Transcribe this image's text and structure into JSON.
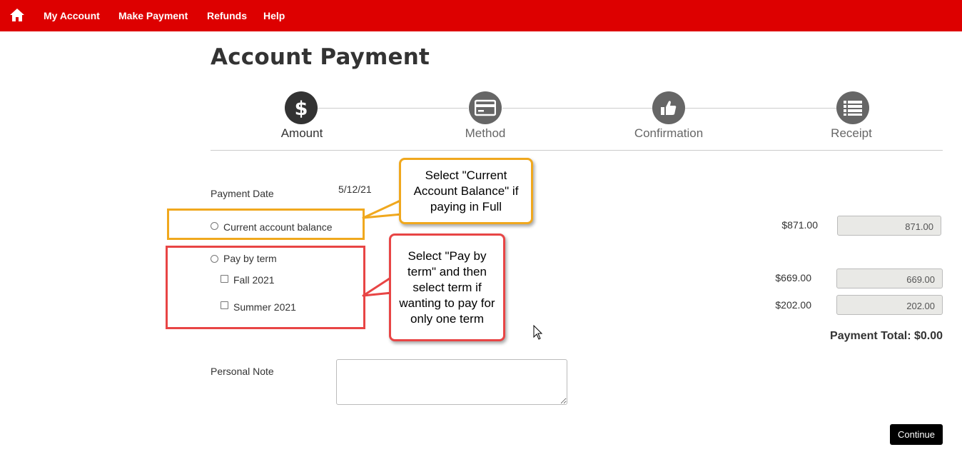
{
  "nav": {
    "home_icon": "home-icon",
    "items": [
      "My Account",
      "Make Payment",
      "Refunds",
      "Help"
    ]
  },
  "page": {
    "title": "Account Payment"
  },
  "steps": [
    {
      "label": "Amount",
      "icon": "dollar-icon",
      "active": true
    },
    {
      "label": "Method",
      "icon": "credit-card-icon",
      "active": false
    },
    {
      "label": "Confirmation",
      "icon": "thumbs-up-icon",
      "active": false
    },
    {
      "label": "Receipt",
      "icon": "list-icon",
      "active": false
    }
  ],
  "form": {
    "payment_date_label": "Payment Date",
    "payment_date_value": "5/12/21",
    "current_balance_label": "Current account balance",
    "current_balance_amount": "$871.00",
    "current_balance_input": "871.00",
    "pay_by_term_label": "Pay by term",
    "terms": [
      {
        "label": "Fall 2021",
        "amount": "$669.00",
        "input": "669.00"
      },
      {
        "label": "Summer 2021",
        "amount": "$202.00",
        "input": "202.00"
      }
    ],
    "payment_total": "Payment Total: $0.00",
    "personal_note_label": "Personal Note",
    "personal_note_value": "",
    "continue_label": "Continue"
  },
  "callouts": {
    "balance": "Select \"Current Account Balance\" if paying in Full",
    "term": "Select \"Pay by term\" and then select  term if wanting to pay for only one term"
  },
  "colors": {
    "brand_red": "#dd0000",
    "callout_orange": "#f0a81e",
    "callout_red": "#e84545"
  }
}
